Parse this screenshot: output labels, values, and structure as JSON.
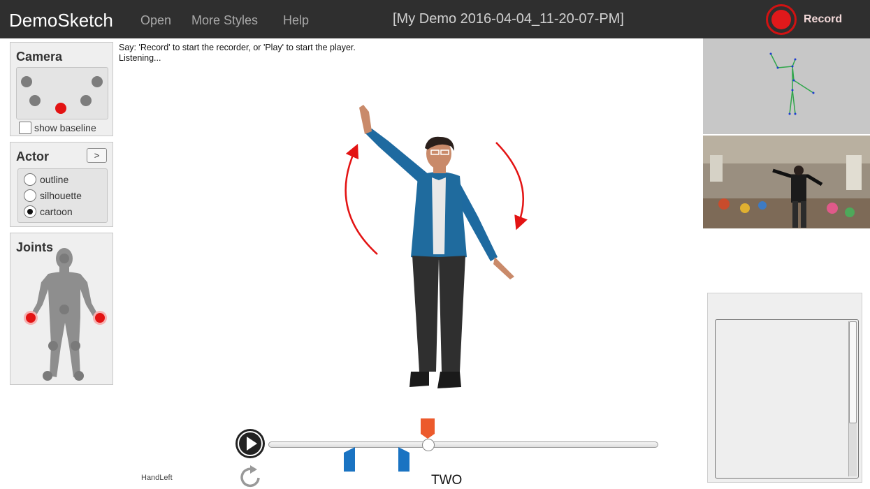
{
  "app": {
    "title": "DemoSketch",
    "document_title": "[My Demo 2016-04-04_11-20-07-PM]"
  },
  "menu": [
    {
      "label": "Open"
    },
    {
      "label": "More Styles"
    },
    {
      "label": "Help"
    }
  ],
  "record": {
    "label": "Record",
    "color": "#e0191b"
  },
  "camera_panel": {
    "title": "Camera",
    "show_baseline_label": "show baseline",
    "show_baseline_checked": false,
    "active_camera": "front-center"
  },
  "actor_panel": {
    "title": "Actor",
    "expand_label": ">",
    "styles": [
      {
        "label": "outline",
        "checked": false
      },
      {
        "label": "silhouette",
        "checked": false
      },
      {
        "label": "cartoon",
        "checked": true
      }
    ]
  },
  "joints_panel": {
    "title": "Joints",
    "active_joints": [
      "HandLeft",
      "HandRight"
    ]
  },
  "messages": {
    "line1": "Say: 'Record' to start the recorder, or 'Play' to start the player.",
    "line2": "Listening..."
  },
  "player": {
    "selected_joint": "HandLeft",
    "phrase": "TWO",
    "playhead_position": 0.41,
    "markers": [
      0.21,
      0.35
    ]
  },
  "colors": {
    "accent_red": "#e31313",
    "marker_blue": "#1a73c2",
    "playhead_orange": "#ec5a2c",
    "topbar": "#2f2f2f"
  }
}
